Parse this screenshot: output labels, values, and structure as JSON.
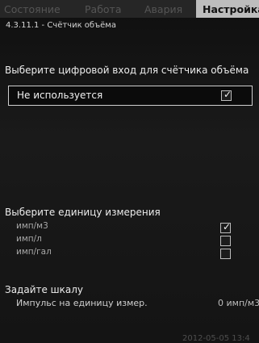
{
  "tabs": {
    "status": "Состояние",
    "operation": "Работа",
    "alarm": "Авария",
    "settings": "Настройка"
  },
  "breadcrumb": "4.3.11.1 - Счётчик объёма",
  "digital_input": {
    "title": "Выберите цифровой вход для счётчика объёма",
    "selected": "Не используется",
    "checked": true
  },
  "units": {
    "title": "Выберите единицу измерения",
    "options": [
      {
        "label": "имп/м3",
        "checked": true
      },
      {
        "label": "имп/л",
        "checked": false
      },
      {
        "label": "имп/гал",
        "checked": false
      }
    ]
  },
  "scale": {
    "title": "Задайте шкалу",
    "param_label": "Импульс на единицу измер.",
    "param_value": "0 имп/м3"
  },
  "footer": {
    "datetime": "2012-05-05 13:4"
  },
  "icons": {
    "checkmark": "check-icon"
  }
}
